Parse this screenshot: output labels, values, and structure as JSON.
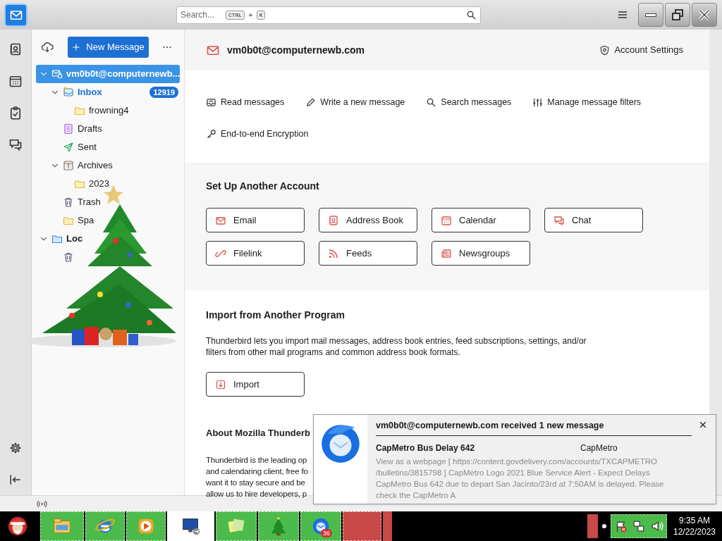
{
  "top_bar": {
    "search_placeholder": "Search...",
    "shortcut_keys": [
      "CTRL",
      "K"
    ],
    "shortcut_joiner": "+"
  },
  "spaces": [
    {
      "kind": "mail",
      "selected": true
    },
    {
      "kind": "address-book",
      "selected": false
    },
    {
      "kind": "calendar",
      "selected": false
    },
    {
      "kind": "tasks",
      "selected": false
    },
    {
      "kind": "chat",
      "selected": false
    }
  ],
  "folder_pane": {
    "new_message": "New Message",
    "accounts": [
      {
        "name": "vm0b0t@computernewb...",
        "kind": "imap",
        "selected": true,
        "expanded": true,
        "folders": [
          {
            "kind": "inbox",
            "label": "Inbox",
            "count": "12919",
            "unread": true,
            "expanded": true,
            "children": [
              {
                "kind": "folder",
                "label": "frowning4"
              }
            ]
          },
          {
            "kind": "drafts",
            "label": "Drafts"
          },
          {
            "kind": "sent",
            "label": "Sent"
          },
          {
            "kind": "archives",
            "label": "Archives",
            "expanded": true,
            "children": [
              {
                "kind": "folder",
                "label": "2023"
              }
            ]
          },
          {
            "kind": "trash",
            "label": "Trash"
          },
          {
            "kind": "folder",
            "label": "Spa"
          }
        ]
      },
      {
        "name": "Loc",
        "kind": "local",
        "selected": false,
        "expanded": true,
        "folders": [
          {
            "kind": "trash"
          }
        ]
      }
    ]
  },
  "account_hub": {
    "email": "vm0b0t@computernewb.com",
    "settings": "Account Settings",
    "actions": [
      {
        "kind": "read",
        "label": "Read messages"
      },
      {
        "kind": "write",
        "label": "Write a new message"
      },
      {
        "kind": "search",
        "label": "Search messages"
      },
      {
        "kind": "filters",
        "label": "Manage message filters"
      },
      {
        "kind": "key",
        "label": "End-to-end Encryption"
      }
    ],
    "setup": {
      "title": "Set Up Another Account",
      "options": [
        {
          "kind": "email",
          "label": "Email"
        },
        {
          "kind": "address-book",
          "label": "Address Book"
        },
        {
          "kind": "calendar",
          "label": "Calendar"
        },
        {
          "kind": "chat",
          "label": "Chat"
        },
        {
          "kind": "filelink",
          "label": "Filelink"
        },
        {
          "kind": "feeds",
          "label": "Feeds"
        },
        {
          "kind": "newsgroups",
          "label": "Newsgroups"
        }
      ]
    },
    "import": {
      "title": "Import from Another Program",
      "text": "Thunderbird lets you import mail messages, address book entries, feed subscriptions, settings, and/or filters from other mail programs and common address book formats.",
      "button": "Import"
    },
    "about": {
      "title": "About Mozilla Thunderb",
      "lines": [
        "Thunderbird is the leading op",
        "and calendaring client, free fo",
        "want it to stay secure and be",
        "allow us to hire developers, p"
      ]
    }
  },
  "notification": {
    "title": "vm0b0t@computernewb.com received 1 new message",
    "subject": "CapMetro Bus Delay 642",
    "sender": "CapMetro",
    "preview": "View as a webpage [ https://content.govdelivery.com/accounts/TXCAPMETRO /bulletins/3815798 ] CapMetro Logo 2021 Blue Service Alert - Expect Delays CapMetro Bus 642 due to depart San Jacinto/23rd at 7:50AM is delayed. Please check the CapMetro A"
  },
  "taskbar": {
    "apps": [
      {
        "kind": "explorer"
      },
      {
        "kind": "browser"
      },
      {
        "kind": "media"
      },
      {
        "kind": "remote"
      },
      {
        "kind": "notes"
      },
      {
        "kind": "tree"
      },
      {
        "kind": "thunderbird",
        "badge": "36"
      },
      {
        "kind": "blank"
      },
      {
        "kind": "blank-small"
      }
    ],
    "clock": {
      "time": "9:35 AM",
      "date": "12/22/2023"
    }
  }
}
